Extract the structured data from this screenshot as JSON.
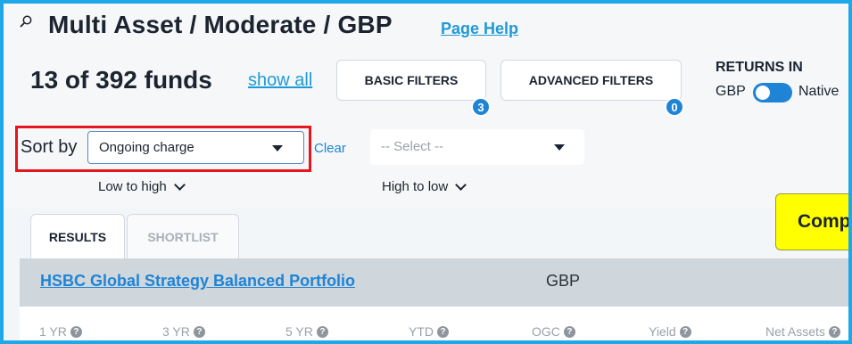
{
  "header": {
    "title": "Multi Asset / Moderate / GBP",
    "page_help": "Page Help",
    "search_icon": "search-icon"
  },
  "summary": {
    "fund_count": "13 of 392 funds",
    "show_all": "show all"
  },
  "filters": {
    "basic_label": "BASIC FILTERS",
    "basic_count": "3",
    "advanced_label": "ADVANCED FILTERS",
    "advanced_count": "0"
  },
  "returns": {
    "label": "RETURNS IN",
    "left_option": "GBP",
    "right_option": "Native",
    "toggle_on": true
  },
  "sort": {
    "label": "Sort by",
    "selected": "Ongoing charge",
    "clear": "Clear",
    "secondary_placeholder": "-- Select --",
    "primary_order": "Low to high",
    "secondary_order": "High to low"
  },
  "tabs": [
    {
      "label": "RESULTS",
      "active": true
    },
    {
      "label": "SHORTLIST",
      "active": false
    }
  ],
  "compare": {
    "label": "Comp"
  },
  "fund": {
    "name": "HSBC Global Strategy Balanced Portfolio",
    "currency": "GBP",
    "metrics": [
      "1 YR",
      "3 YR",
      "5 YR",
      "YTD",
      "OGC",
      "Yield",
      "Net Assets"
    ]
  },
  "colors": {
    "accent": "#1f84d6",
    "link": "#1f9ad6",
    "frame": "#1ea8e8",
    "highlight": "#e5161d",
    "compare": "#ffff00"
  }
}
